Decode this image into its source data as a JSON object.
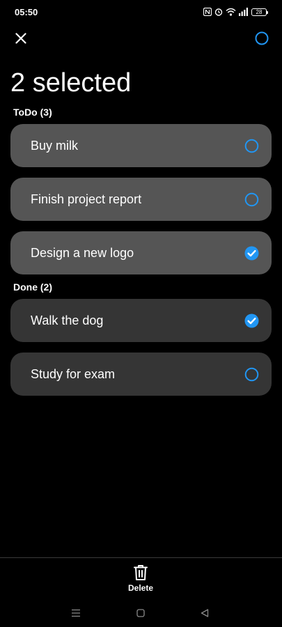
{
  "status_bar": {
    "time": "05:50",
    "battery": "28"
  },
  "header": {
    "title": "2 selected",
    "close_icon": "close-icon",
    "select_all_icon": "circle-outline-icon"
  },
  "sections": [
    {
      "header": "ToDo (3)",
      "tasks": [
        {
          "label": "Buy milk",
          "selected": false
        },
        {
          "label": "Finish project report",
          "selected": false
        },
        {
          "label": "Design a new logo",
          "selected": true
        }
      ]
    },
    {
      "header": "Done (2)",
      "tasks": [
        {
          "label": "Walk the dog",
          "selected": true
        },
        {
          "label": "Study for exam",
          "selected": false
        }
      ]
    }
  ],
  "bottom_bar": {
    "delete_label": "Delete",
    "delete_icon": "trash-icon"
  },
  "colors": {
    "accent": "#2196f3",
    "background": "#000000",
    "todo_card": "#555555",
    "done_card": "#353535"
  }
}
